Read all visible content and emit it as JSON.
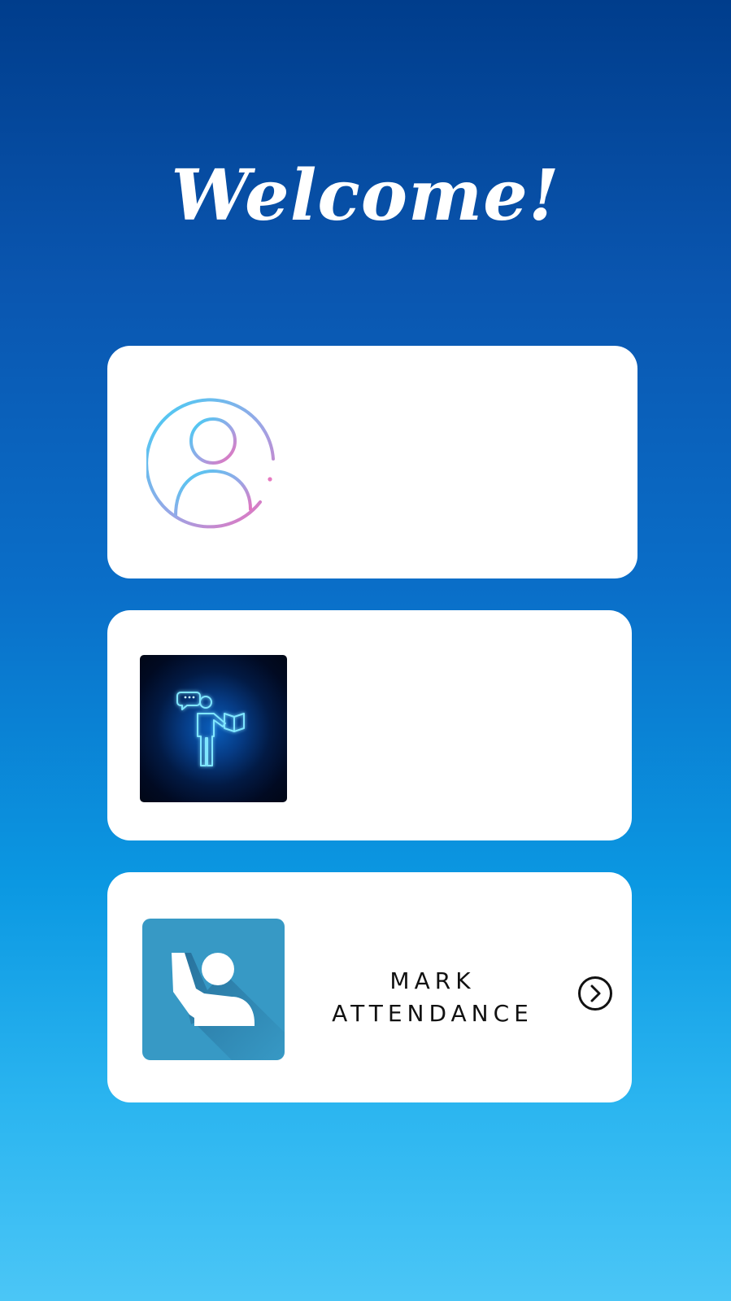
{
  "header": {
    "title": "Welcome!"
  },
  "cards": [
    {
      "id": "profile",
      "icon": "user-profile-icon"
    },
    {
      "id": "teacher",
      "icon": "teacher-with-book-icon"
    },
    {
      "id": "attendance",
      "icon": "raised-hand-icon",
      "label_line1": "MARK",
      "label_line2": "ATTENDANCE",
      "action_icon": "chevron-right-circle-icon"
    }
  ],
  "colors": {
    "gradient_top": "#003d8c",
    "gradient_bottom": "#4bc6f6",
    "card_background": "#ffffff",
    "hand_tile": "#3799c5",
    "teacher_tile": "#010a22",
    "profile_gradient_start": "#3fd0f5",
    "profile_gradient_end": "#f06bb8"
  }
}
